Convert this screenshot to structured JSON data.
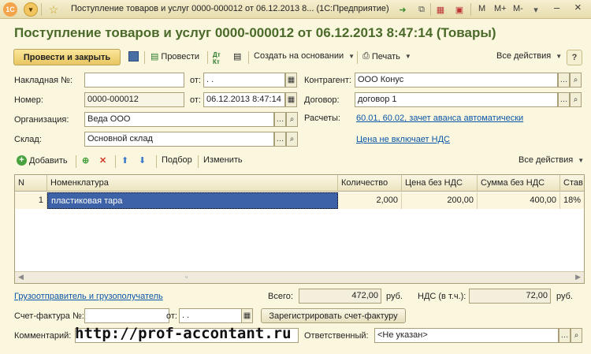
{
  "window": {
    "title": "Поступление товаров и услуг 0000-000012 от 06.12.2013 8...  (1С:Предприятие)",
    "m_label": "M",
    "mplus_label": "M+",
    "mminus_label": "M-",
    "minimize": "–",
    "close": "×"
  },
  "document": {
    "title": "Поступление товаров и услуг 0000-000012 от 06.12.2013 8:47:14 (Товары)"
  },
  "toolbar": {
    "post_close": "Провести и закрыть",
    "post": "Провести",
    "create_based": "Создать на основании",
    "print": "Печать",
    "all_actions": "Все действия",
    "help": "?"
  },
  "form": {
    "invoice_label": "Накладная №:",
    "invoice_value": "",
    "from_label": "от:",
    "invoice_date": " .  .",
    "number_label": "Номер:",
    "number_value": "0000-000012",
    "number_date_label": "от:",
    "number_date": "06.12.2013  8:47:14",
    "org_label": "Организация:",
    "org_value": "Веда ООО",
    "warehouse_label": "Склад:",
    "warehouse_value": "Основной склад",
    "counterparty_label": "Контрагент:",
    "counterparty_value": "ООО Конус",
    "contract_label": "Договор:",
    "contract_value": "договор 1",
    "settlements_label": "Расчеты:",
    "settlements_link": "60.01, 60.02, зачет аванса автоматически",
    "vat_link": "Цена не включает НДС"
  },
  "table_toolbar": {
    "add": "Добавить",
    "selection": "Подбор",
    "change": "Изменить",
    "all_actions": "Все действия"
  },
  "table": {
    "columns": [
      "N",
      "Номенклатура",
      "Количество",
      "Цена без НДС",
      "Сумма без НДС",
      "Став"
    ],
    "rows": [
      {
        "n": "1",
        "item": "пластиковая тара",
        "qty": "2,000",
        "price": "200,00",
        "sum": "400,00",
        "rate": "18%"
      }
    ]
  },
  "footer": {
    "consignor_link": "Грузоотправитель и грузополучатель",
    "total_label": "Всего:",
    "total_value": "472,00",
    "currency": "руб.",
    "vat_label": "НДС (в т.ч.):",
    "vat_value": "72,00",
    "vat_currency": "руб.",
    "sf_label": "Счет-фактура №:",
    "sf_value": "",
    "sf_from_label": "от:",
    "sf_date": " .  .",
    "register_button": "Зарегистрировать счет-фактуру",
    "comment_label": "Комментарий:",
    "comment_value": "",
    "responsible_label": "Ответственный:",
    "responsible_value": "<Не указан>",
    "watermark": "http://prof-accontant.ru"
  },
  "colors": {
    "background": "#fbf7de",
    "title_green": "#4b6a2a",
    "link_blue": "#0b56a8",
    "selection_blue": "#3d62a8",
    "primary_button": "#f0d277"
  }
}
